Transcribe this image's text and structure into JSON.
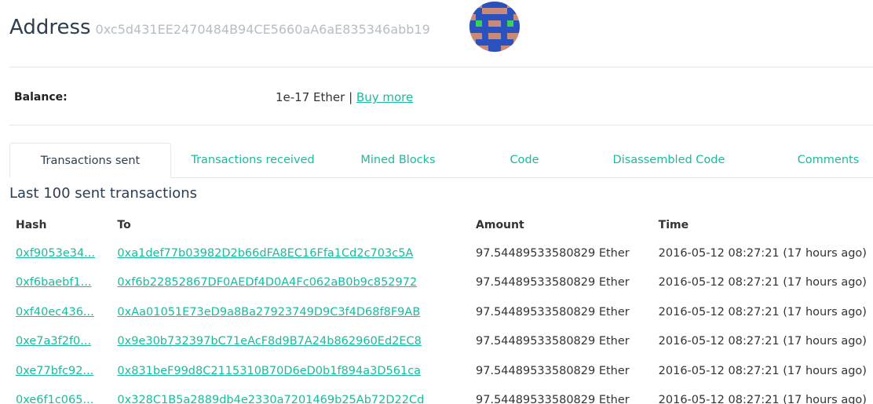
{
  "header": {
    "title": "Address",
    "address": "0xc5d431EE2470484B94CE5660aA6aE835346abb19"
  },
  "identicon": {
    "colors": {
      "background": "#c98b78",
      "primary": "#2a52be",
      "accent": "#3ad05a"
    }
  },
  "balance": {
    "label": "Balance:",
    "value": "1e-17 Ether",
    "separator": " | ",
    "link": "Buy more"
  },
  "tabs": [
    {
      "label": "Transactions sent",
      "active": true
    },
    {
      "label": "Transactions received"
    },
    {
      "label": "Mined Blocks"
    },
    {
      "label": "Code"
    },
    {
      "label": "Disassembled Code"
    },
    {
      "label": "Comments"
    }
  ],
  "section": {
    "title": "Last 100 sent transactions"
  },
  "table": {
    "headers": {
      "hash": "Hash",
      "to": "To",
      "amount": "Amount",
      "time": "Time"
    },
    "rows": [
      {
        "hash": "0xf9053e34...",
        "to": "0xa1def77b03982D2b66dFA8EC16Ffa1Cd2c703c5A",
        "amount": "97.54489533580829 Ether",
        "time": "2016-05-12 08:27:21 (17 hours ago)"
      },
      {
        "hash": "0xf6baebf1...",
        "to": "0xf6b22852867DF0AEDf4D0A4Fc062aB0b9c852972",
        "amount": "97.54489533580829 Ether",
        "time": "2016-05-12 08:27:21 (17 hours ago)"
      },
      {
        "hash": "0xf40ec436...",
        "to": "0xAa01051E73eD9a8Ba27923749D9C3f4D68f8F9AB",
        "amount": "97.54489533580829 Ether",
        "time": "2016-05-12 08:27:21 (17 hours ago)"
      },
      {
        "hash": "0xe7a3f2f0...",
        "to": "0x9e30b732397bC71eAcF8d9B7A24b862960Ed2EC8",
        "amount": "97.54489533580829 Ether",
        "time": "2016-05-12 08:27:21 (17 hours ago)"
      },
      {
        "hash": "0xe77bfc92...",
        "to": "0x831beF99d8C2115310B70D6eD0b1f894a3D561ca",
        "amount": "97.54489533580829 Ether",
        "time": "2016-05-12 08:27:21 (17 hours ago)"
      },
      {
        "hash": "0xe6f1c065...",
        "to": "0x328C1B5a2889db4e2330a7201469b25Ab72D22Cd",
        "amount": "97.54489533580829 Ether",
        "time": "2016-05-12 08:27:21 (17 hours ago)"
      }
    ]
  }
}
